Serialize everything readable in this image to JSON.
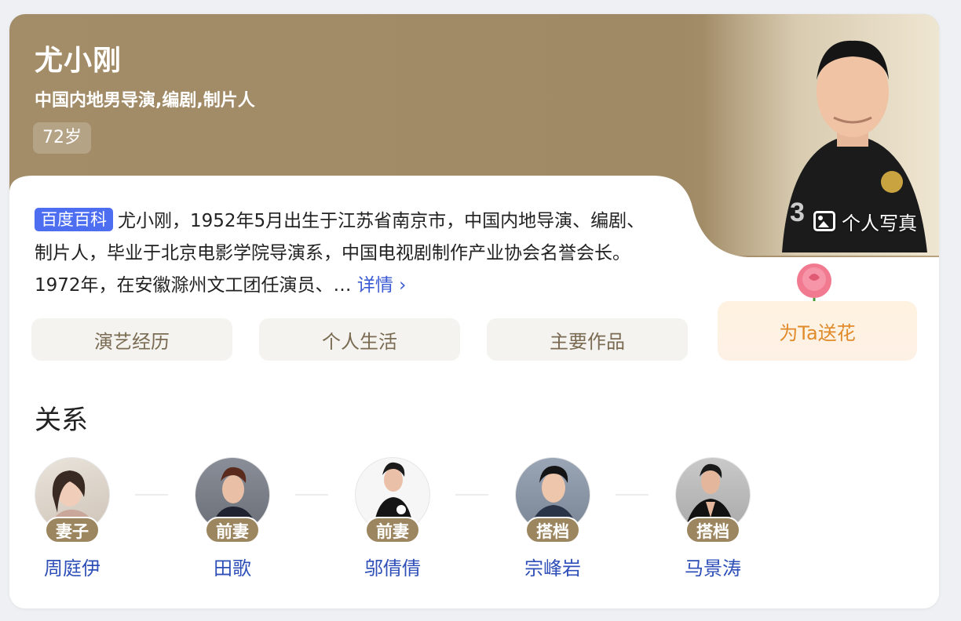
{
  "profile": {
    "name": "尤小刚",
    "subtitle": "中国内地男导演,编剧,制片人",
    "age": "72岁",
    "photo_button": "个人写真"
  },
  "intro": {
    "badge": "百度百科",
    "text": "尤小刚，1952年5月出生于江苏省南京市，中国内地导演、编剧、制片人，毕业于北京电影学院导演系，中国电视剧制作产业协会名誉会长。1972年，在安徽滁州文工团任演员、…",
    "more_label": "详情 ›"
  },
  "tabs": [
    {
      "label": "演艺经历"
    },
    {
      "label": "个人生活"
    },
    {
      "label": "主要作品"
    }
  ],
  "flower_button": {
    "label": "为Ta送花"
  },
  "relations": {
    "title": "关系",
    "people": [
      {
        "tag": "妻子",
        "name": "周庭伊"
      },
      {
        "tag": "前妻",
        "name": "田歌"
      },
      {
        "tag": "前妻",
        "name": "邬倩倩"
      },
      {
        "tag": "搭档",
        "name": "宗峰岩"
      },
      {
        "tag": "搭档",
        "name": "马景涛"
      }
    ]
  },
  "colors": {
    "hero_bg": "#a08a66",
    "badge_bg": "#4e6ef2",
    "link": "#2e4fb8",
    "tag_bg": "#9c8660",
    "flower_text": "#e08a2a"
  },
  "icons": [
    "photo-album-icon",
    "rose-icon",
    "chevron-right-icon"
  ]
}
